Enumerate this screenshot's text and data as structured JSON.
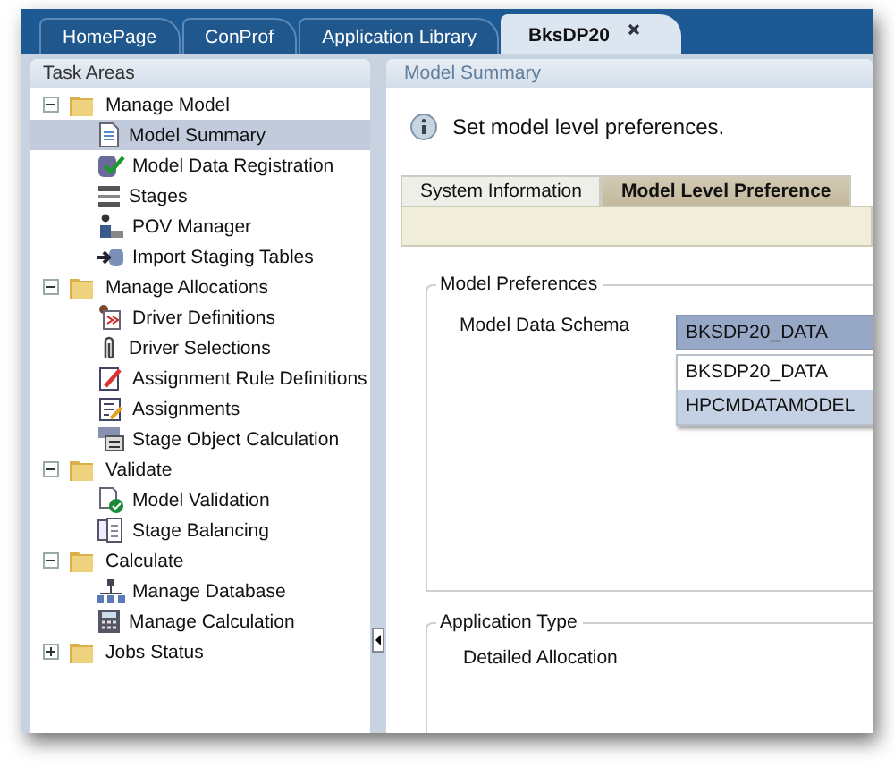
{
  "tabs": [
    {
      "label": "HomePage",
      "selected": false,
      "closable": false
    },
    {
      "label": "ConProf",
      "selected": false,
      "closable": false
    },
    {
      "label": "Application Library",
      "selected": false,
      "closable": false
    },
    {
      "label": "BksDP20",
      "selected": true,
      "closable": true
    }
  ],
  "sidebar": {
    "title": "Task Areas",
    "tree": [
      {
        "label": "Manage Model",
        "expanded": true,
        "children": [
          {
            "label": "Model Summary",
            "selected": true
          },
          {
            "label": "Model Data Registration",
            "selected": false
          },
          {
            "label": "Stages",
            "selected": false
          },
          {
            "label": "POV Manager",
            "selected": false
          },
          {
            "label": "Import Staging Tables",
            "selected": false
          }
        ]
      },
      {
        "label": "Manage Allocations",
        "expanded": true,
        "children": [
          {
            "label": "Driver Definitions",
            "selected": false
          },
          {
            "label": "Driver Selections",
            "selected": false
          },
          {
            "label": "Assignment Rule Definitions",
            "selected": false
          },
          {
            "label": "Assignments",
            "selected": false
          },
          {
            "label": "Stage Object Calculation",
            "selected": false
          }
        ]
      },
      {
        "label": "Validate",
        "expanded": true,
        "children": [
          {
            "label": "Model Validation",
            "selected": false
          },
          {
            "label": "Stage Balancing",
            "selected": false
          }
        ]
      },
      {
        "label": "Calculate",
        "expanded": true,
        "children": [
          {
            "label": "Manage Database",
            "selected": false
          },
          {
            "label": "Manage Calculation",
            "selected": false
          }
        ]
      },
      {
        "label": "Jobs Status",
        "expanded": false
      }
    ]
  },
  "main": {
    "title": "Model Summary",
    "info": "Set model level preferences.",
    "tabs": [
      {
        "label": "System Information",
        "selected": false
      },
      {
        "label": "Model Level Preference",
        "selected": true
      }
    ],
    "model_preferences": {
      "legend": "Model Preferences",
      "label": "Model Data Schema",
      "value": "BKSDP20_DATA",
      "options": [
        {
          "label": "BKSDP20_DATA",
          "highlighted": false
        },
        {
          "label": "HPCMDATAMODEL",
          "highlighted": true
        }
      ]
    },
    "application_type": {
      "legend": "Application Type",
      "value": "Detailed Allocation"
    }
  }
}
